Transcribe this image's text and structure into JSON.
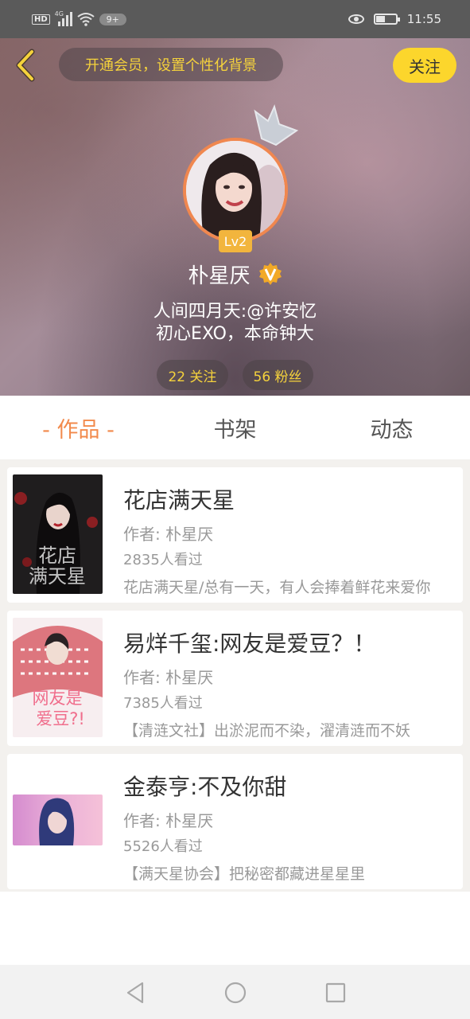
{
  "status_bar": {
    "hd": "HD",
    "network": "4G",
    "notification_count": "9+",
    "time": "11:55",
    "battery_level": 0.45,
    "icons": [
      "hd-icon",
      "signal-icon",
      "wifi-icon",
      "eye-icon",
      "battery-icon"
    ]
  },
  "header": {
    "back_icon": "chevron-left-icon",
    "vip_promo": "开通会员，设置个性化背景",
    "follow_label": "关注",
    "level_badge": "Lv2",
    "username": "朴星厌",
    "verified_icon": "verified-v-icon",
    "bio_line1": "人间四月天:@许安忆",
    "bio_line2": "初心EXO，本命钟大",
    "following": "22 关注",
    "followers": "56 粉丝"
  },
  "tabs": [
    {
      "label": "- 作品 -",
      "active": true
    },
    {
      "label": "书架",
      "active": false
    },
    {
      "label": "动态",
      "active": false
    }
  ],
  "works": [
    {
      "title": "花店满天星",
      "author": "作者: 朴星厌",
      "views": "2835人看过",
      "desc": "花店满天星/总有一天，有人会捧着鲜花来爱你",
      "cover_text": "花店满天星"
    },
    {
      "title": "易烊千玺:网友是爱豆？！",
      "author": "作者: 朴星厌",
      "views": "7385人看过",
      "desc": "【清涟文社】出淤泥而不染，濯清涟而不妖",
      "cover_text": "网友是爱豆?!"
    },
    {
      "title": "金泰亨:不及你甜",
      "author": "作者: 朴星厌",
      "views": "5526人看过",
      "desc": "【满天星协会】把秘密都藏进星星里"
    }
  ],
  "nav": {
    "back_icon": "triangle-back-icon",
    "home_icon": "circle-home-icon",
    "recent_icon": "square-recent-icon"
  },
  "colors": {
    "accent": "#f28a4c",
    "gold": "#f5d23c",
    "follow_bg": "#fcd62c",
    "level_bg": "#f2b53d"
  }
}
